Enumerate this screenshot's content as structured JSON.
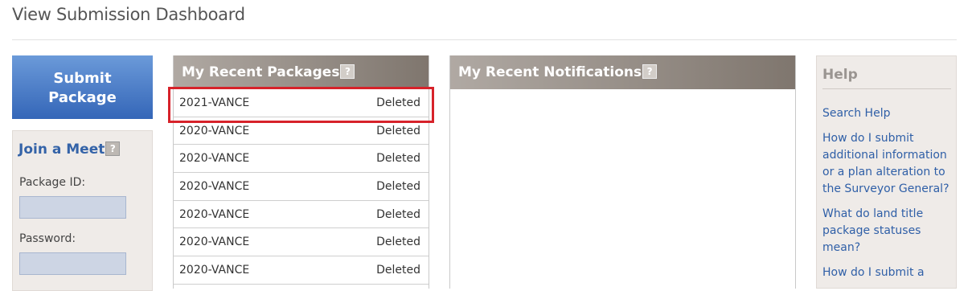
{
  "page": {
    "title": "View Submission Dashboard"
  },
  "submit": {
    "label_line1": "Submit",
    "label_line2": "Package"
  },
  "join": {
    "title": "Join a Meet",
    "help_icon": "question-mark-icon",
    "package_id_label": "Package ID:",
    "package_id_value": "",
    "password_label": "Password:",
    "password_value": ""
  },
  "packages": {
    "title": "My Recent Packages",
    "help_icon": "question-mark-icon",
    "rows": [
      {
        "name": "2021-VANCE",
        "status": "Deleted"
      },
      {
        "name": "2020-VANCE",
        "status": "Deleted"
      },
      {
        "name": "2020-VANCE",
        "status": "Deleted"
      },
      {
        "name": "2020-VANCE",
        "status": "Deleted"
      },
      {
        "name": "2020-VANCE",
        "status": "Deleted"
      },
      {
        "name": "2020-VANCE",
        "status": "Deleted"
      },
      {
        "name": "2020-VANCE",
        "status": "Deleted"
      }
    ]
  },
  "notifications": {
    "title": "My Recent Notifications",
    "help_icon": "question-mark-icon"
  },
  "help": {
    "title": "Help",
    "links": [
      "Search Help",
      "How do I submit additional information or a plan alteration to the Surveyor General?",
      "What do land title package statuses mean?",
      "How do I submit a"
    ]
  },
  "colors": {
    "accent_blue": "#3466b8",
    "highlight_red": "#d7222a",
    "link_blue": "#2f5fa7"
  }
}
